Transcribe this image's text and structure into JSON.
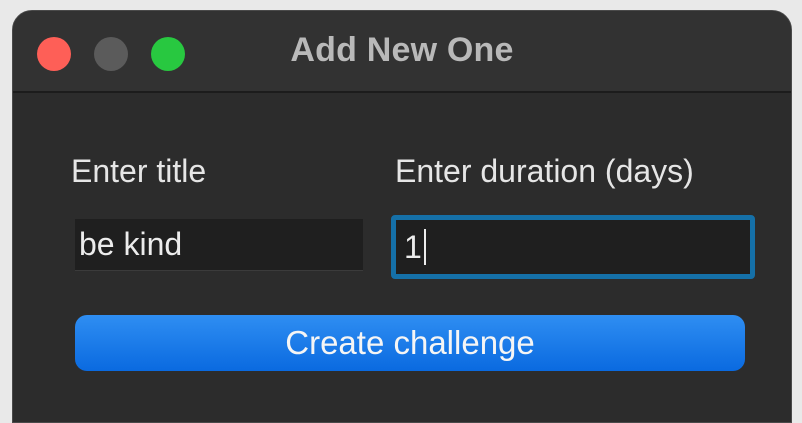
{
  "window": {
    "title": "Add New One"
  },
  "form": {
    "title_label": "Enter title",
    "title_value": "be kind",
    "duration_label": "Enter duration (days)",
    "duration_value": "1",
    "submit_label": "Create challenge"
  },
  "colors": {
    "close": "#fe5f57",
    "minimize": "#5b5b5b",
    "zoom": "#28c840",
    "accent": "#0a6ae0",
    "focus_ring": "#1570a8"
  }
}
